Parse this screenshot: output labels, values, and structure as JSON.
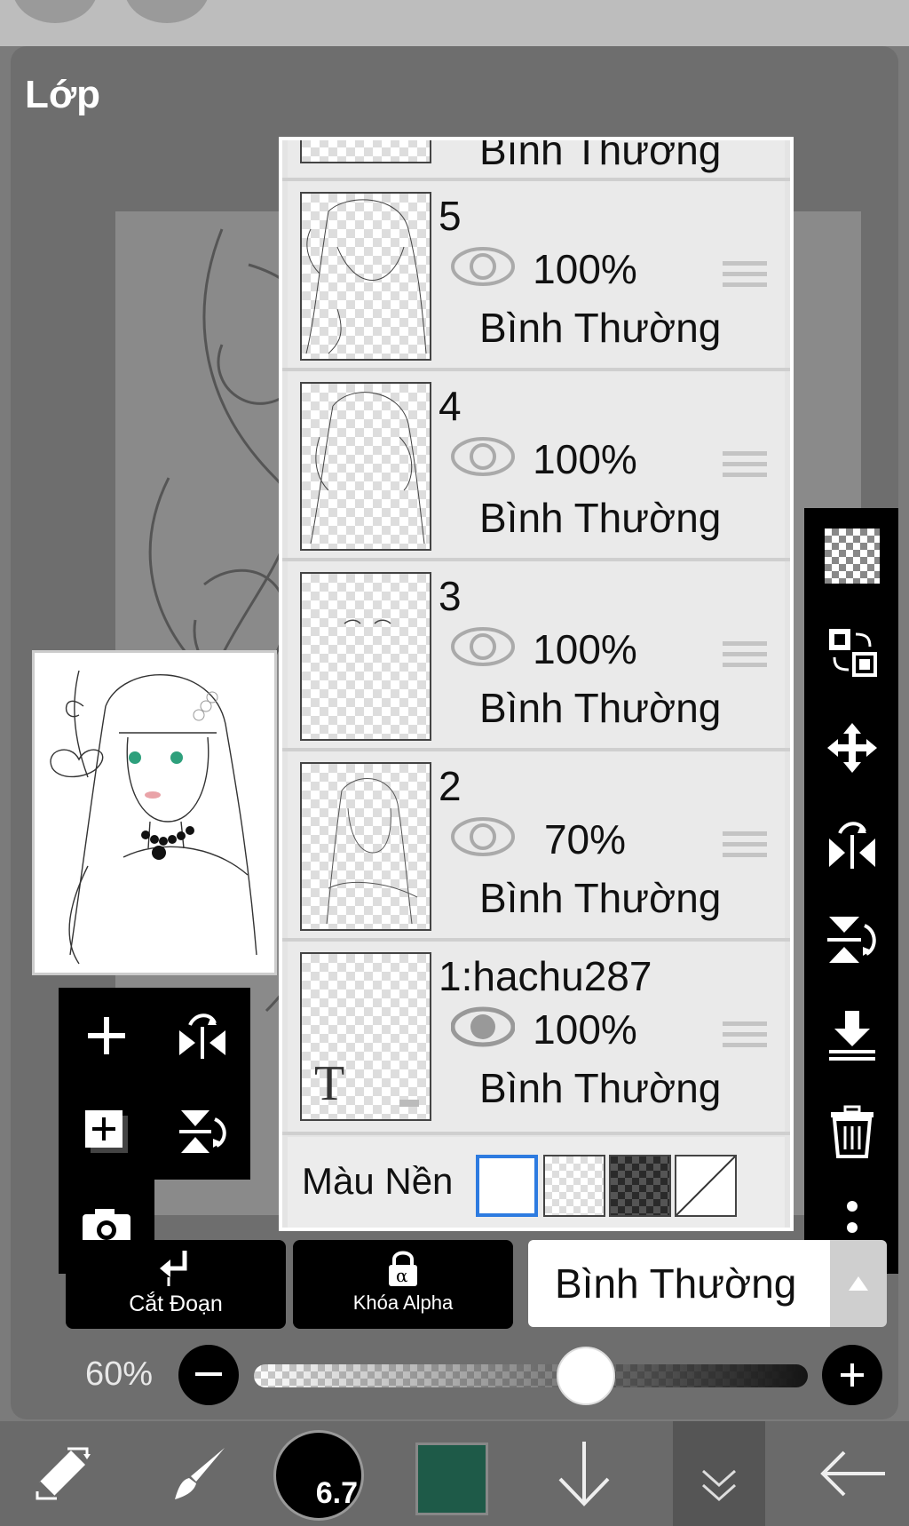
{
  "panel": {
    "title": "Lớp"
  },
  "layers": {
    "top_partial_blend": "Bình Thường",
    "items": [
      {
        "name": "5",
        "opacity": "100%",
        "blend": "Bình Thường",
        "visible": true
      },
      {
        "name": "4",
        "opacity": "100%",
        "blend": "Bình Thường",
        "visible": true
      },
      {
        "name": "3",
        "opacity": "100%",
        "blend": "Bình Thường",
        "visible": true
      },
      {
        "name": "2",
        "opacity": "70%",
        "blend": "Bình Thường",
        "visible": true
      },
      {
        "name": "1:hachu287",
        "opacity": "100%",
        "blend": "Bình Thường",
        "visible": true,
        "selected": true
      }
    ]
  },
  "background": {
    "label": "Màu Nền"
  },
  "actions": {
    "clip_label": "Cắt Đoạn",
    "alpha_label": "Khóa Alpha"
  },
  "blend_mode": {
    "value": "Bình Thường"
  },
  "opacity_slider": {
    "value_label": "60%",
    "value": 0.6
  },
  "toolbar": {
    "brush_size": "6.7",
    "color": "#1e5a48"
  },
  "colors": {
    "accent": "#2d7be0",
    "panel": "#6e6e6e"
  },
  "icons": {
    "right": [
      "checker-icon",
      "swap-layers-icon",
      "move-icon",
      "flip-horizontal-icon",
      "flip-vertical-icon",
      "merge-down-icon",
      "trash-icon",
      "more-icon"
    ],
    "left": [
      "add-layer-icon",
      "flip-horizontal-icon",
      "add-layer-copy-icon",
      "flip-vertical-icon",
      "camera-icon"
    ]
  }
}
